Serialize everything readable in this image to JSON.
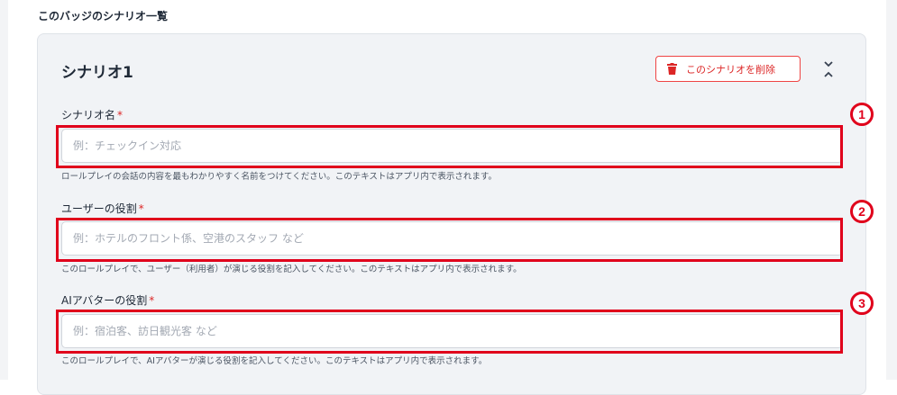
{
  "section": {
    "heading": "このバッジのシナリオ一覧"
  },
  "scenario": {
    "title": "シナリオ1",
    "delete_label": "このシナリオを削除",
    "fields": [
      {
        "label": "シナリオ名",
        "required_mark": "*",
        "placeholder": "例：チェックイン対応",
        "help": "ロールプレイの会話の内容を最もわかりやすく名前をつけてください。このテキストはアプリ内で表示されます。"
      },
      {
        "label": "ユーザーの役割",
        "required_mark": "*",
        "placeholder": "例：ホテルのフロント係、空港のスタッフ など",
        "help": "このロールプレイで、ユーザー（利用者）が演じる役割を記入してください。このテキストはアプリ内で表示されます。"
      },
      {
        "label": "AIアバターの役割",
        "required_mark": "*",
        "placeholder": "例：宿泊客、訪日観光客 など",
        "help": "このロールプレイで、AIアバターが演じる役割を記入してください。このテキストはアプリ内で表示されます。"
      }
    ]
  },
  "callouts": [
    "1",
    "2",
    "3"
  ],
  "colors": {
    "accent_red": "#e0001b",
    "delete_red": "#dc2626",
    "card_bg": "#f1f3f6"
  },
  "icons": {
    "delete": "trash-icon",
    "collapse": "collapse-icon"
  }
}
